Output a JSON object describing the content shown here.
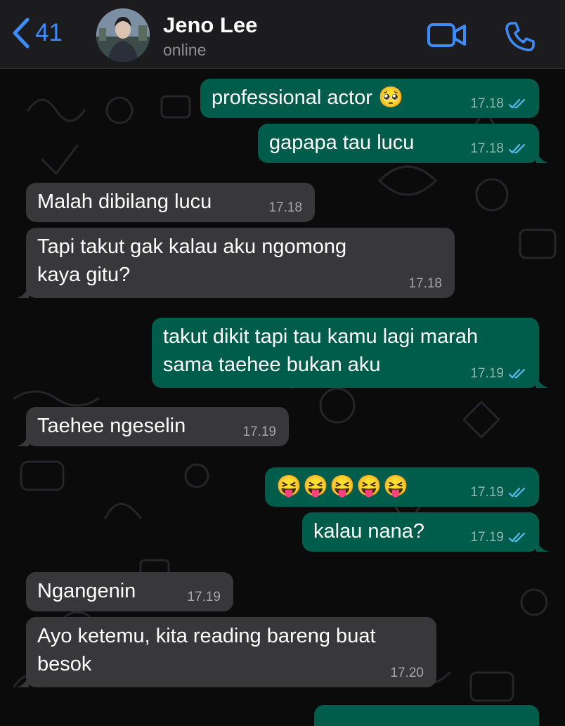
{
  "header": {
    "back_count": "41",
    "contact_name": "Jeno Lee",
    "status": "online"
  },
  "colors": {
    "accent": "#3d8bf7",
    "outgoing_bubble": "#005c4b",
    "incoming_bubble": "#38383a",
    "read_ticks": "#53bdeb"
  },
  "icons": {
    "back": "chevron-left-icon",
    "video": "video-camera-icon",
    "call": "phone-icon",
    "read_receipt": "double-check-icon"
  },
  "messages": [
    {
      "direction": "out",
      "text": "professional actor 🥺",
      "time": "17.18",
      "read": true
    },
    {
      "direction": "out",
      "text": "gapapa tau lucu",
      "time": "17.18",
      "read": true
    },
    {
      "direction": "in",
      "text": "Malah dibilang lucu",
      "time": "17.18"
    },
    {
      "direction": "in",
      "text": "Tapi takut gak kalau aku ngomong kaya gitu?",
      "time": "17.18"
    },
    {
      "direction": "out",
      "text": "takut dikit tapi tau kamu lagi marah sama taehee bukan aku",
      "time": "17.19",
      "read": true
    },
    {
      "direction": "in",
      "text": "Taehee ngeselin",
      "time": "17.19"
    },
    {
      "direction": "out",
      "text": "😝😝😝😝😝",
      "time": "17.19",
      "read": true
    },
    {
      "direction": "out",
      "text": "kalau nana?",
      "time": "17.19",
      "read": true
    },
    {
      "direction": "in",
      "text": "Ngangenin",
      "time": "17.19"
    },
    {
      "direction": "in",
      "text": "Ayo ketemu, kita reading bareng buat besok",
      "time": "17.20"
    }
  ]
}
